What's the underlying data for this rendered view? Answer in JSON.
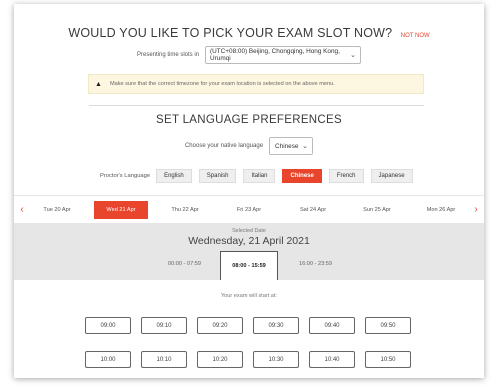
{
  "header": {
    "title": "WOULD YOU LIKE TO PICK YOUR EXAM SLOT NOW?",
    "not_now": "NOT NOW"
  },
  "timezone": {
    "label": "Presenting time slots in",
    "value": "(UTC+08:00) Beijing, Chongqing, Hong Kong, Urumqi"
  },
  "warning": {
    "icon": "warning-icon",
    "text": "Make sure that the correct timezone for your exam location is selected on the above menu."
  },
  "language": {
    "title": "SET LANGUAGE PREFERENCES",
    "native_label": "Choose your native language",
    "native_value": "Chinese",
    "proctor_label": "Proctor's Language",
    "options": [
      "English",
      "Spanish",
      "Italian",
      "Chinese",
      "French",
      "Japanese"
    ],
    "selected": "Chinese"
  },
  "dates": {
    "items": [
      "Tue 20 Apr",
      "Wed 21 Apr",
      "Thu 22 Apr",
      "Fri 23 Apr",
      "Sat 24 Apr",
      "Sun 25 Apr",
      "Mon 26 Apr"
    ],
    "selected": "Wed 21 Apr",
    "prev_icon": "chevron-left-icon",
    "next_icon": "chevron-right-icon"
  },
  "selection": {
    "label": "Selected Date",
    "date": "Wednesday, 21 April 2021",
    "ranges": [
      "00:00 - 07:59",
      "08:00 - 15:59",
      "16:00 - 23:59"
    ],
    "selected_range": "08:00 - 15:59",
    "start_label": "Your exam will start at:"
  },
  "slots": {
    "row1": [
      "09:00",
      "09:10",
      "09:20",
      "09:30",
      "09:40",
      "09:50"
    ],
    "row2": [
      "10:00",
      "10:10",
      "10:20",
      "10:30",
      "10:40",
      "10:50"
    ]
  },
  "colors": {
    "accent": "#e8452c",
    "warning_bg": "#fdf6e0",
    "band_bg": "#e6e6e6"
  }
}
